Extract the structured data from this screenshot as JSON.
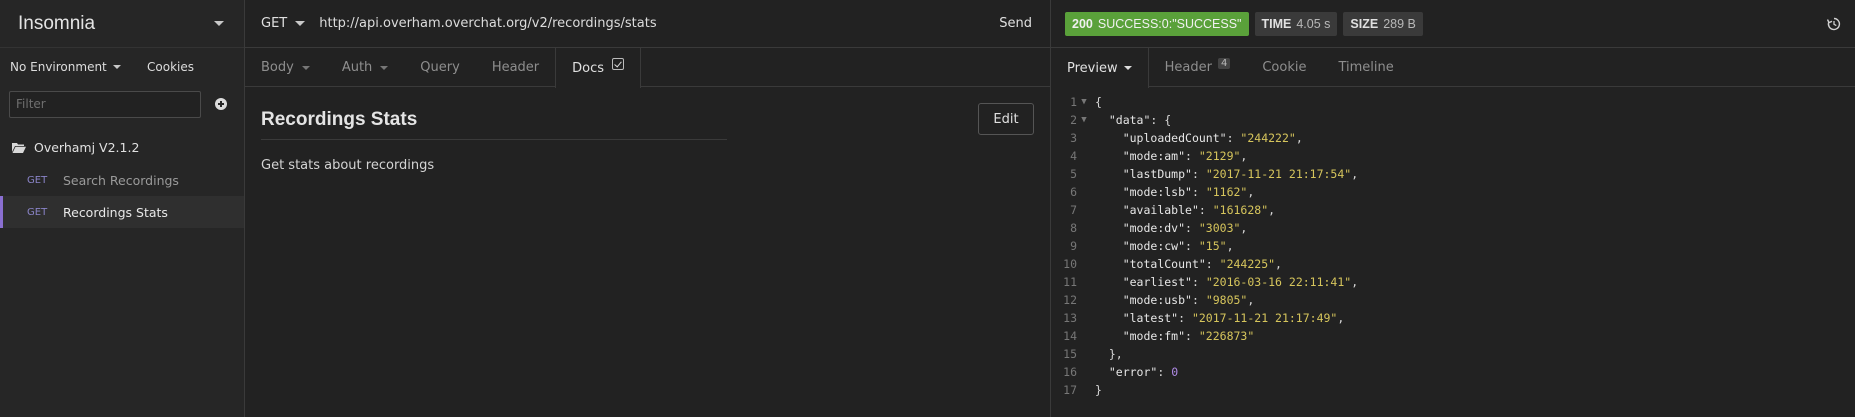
{
  "sidebar": {
    "title": "Insomnia",
    "environment": "No Environment",
    "cookies": "Cookies",
    "filter_placeholder": "Filter",
    "folder": "Overhamj V2.1.2",
    "requests": [
      {
        "method": "GET",
        "name": "Search Recordings"
      },
      {
        "method": "GET",
        "name": "Recordings Stats"
      }
    ]
  },
  "request": {
    "method": "GET",
    "url": "http://api.overham.overchat.org/v2/recordings/stats",
    "send": "Send",
    "tabs": [
      "Body",
      "Auth",
      "Query",
      "Header",
      "Docs"
    ],
    "docs": {
      "title": "Recordings Stats",
      "description": "Get stats about recordings",
      "edit": "Edit"
    }
  },
  "response": {
    "status_code": "200",
    "status_text": "SUCCESS:0:\"SUCCESS\"",
    "time_label": "TIME",
    "time_value": "4.05 s",
    "size_label": "SIZE",
    "size_value": "289 B",
    "tabs": {
      "preview": "Preview",
      "header": "Header",
      "header_count": "4",
      "cookie": "Cookie",
      "timeline": "Timeline"
    },
    "body_lines": [
      {
        "n": "1",
        "fold": true,
        "indent": "",
        "key": "",
        "val": "{",
        "type": "p"
      },
      {
        "n": "2",
        "fold": true,
        "indent": "  ",
        "key": "\"data\"",
        "val": ": {",
        "type": "p"
      },
      {
        "n": "3",
        "indent": "    ",
        "key": "\"uploadedCount\"",
        "val": "\"244222\"",
        "type": "s",
        "comma": true
      },
      {
        "n": "4",
        "indent": "    ",
        "key": "\"mode:am\"",
        "val": "\"2129\"",
        "type": "s",
        "comma": true
      },
      {
        "n": "5",
        "indent": "    ",
        "key": "\"lastDump\"",
        "val": "\"2017-11-21 21:17:54\"",
        "type": "s",
        "comma": true
      },
      {
        "n": "6",
        "indent": "    ",
        "key": "\"mode:lsb\"",
        "val": "\"1162\"",
        "type": "s",
        "comma": true
      },
      {
        "n": "7",
        "indent": "    ",
        "key": "\"available\"",
        "val": "\"161628\"",
        "type": "s",
        "comma": true
      },
      {
        "n": "8",
        "indent": "    ",
        "key": "\"mode:dv\"",
        "val": "\"3003\"",
        "type": "s",
        "comma": true
      },
      {
        "n": "9",
        "indent": "    ",
        "key": "\"mode:cw\"",
        "val": "\"15\"",
        "type": "s",
        "comma": true
      },
      {
        "n": "10",
        "indent": "    ",
        "key": "\"totalCount\"",
        "val": "\"244225\"",
        "type": "s",
        "comma": true
      },
      {
        "n": "11",
        "indent": "    ",
        "key": "\"earliest\"",
        "val": "\"2016-03-16 22:11:41\"",
        "type": "s",
        "comma": true
      },
      {
        "n": "12",
        "indent": "    ",
        "key": "\"mode:usb\"",
        "val": "\"9805\"",
        "type": "s",
        "comma": true
      },
      {
        "n": "13",
        "indent": "    ",
        "key": "\"latest\"",
        "val": "\"2017-11-21 21:17:49\"",
        "type": "s",
        "comma": true
      },
      {
        "n": "14",
        "indent": "    ",
        "key": "\"mode:fm\"",
        "val": "\"226873\"",
        "type": "s",
        "comma": false
      },
      {
        "n": "15",
        "indent": "  ",
        "key": "",
        "val": "},",
        "type": "p"
      },
      {
        "n": "16",
        "indent": "  ",
        "key": "\"error\"",
        "val": "0",
        "type": "n",
        "comma": false
      },
      {
        "n": "17",
        "indent": "",
        "key": "",
        "val": "}",
        "type": "p"
      }
    ]
  },
  "colors": {
    "status_green": "#5aa13a",
    "accent_purple": "#8a6fd1",
    "method_get": "#8a84c8",
    "json_string": "#d6c55c",
    "json_number": "#b08be6"
  }
}
